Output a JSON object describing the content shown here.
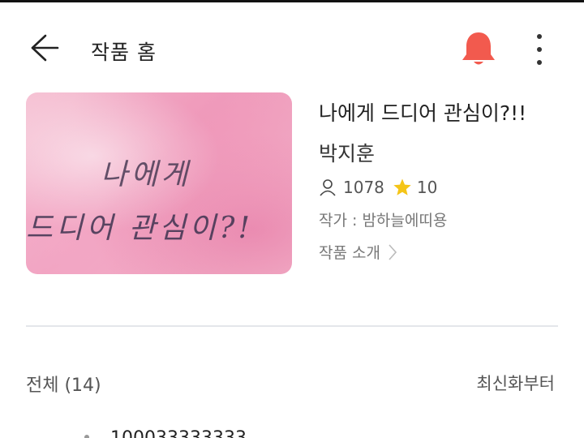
{
  "header": {
    "title": "작품 홈",
    "back_icon": "arrow-left-icon",
    "bell_icon": "bell-icon",
    "bell_color": "#f25a4e",
    "more_icon": "more-vertical-icon"
  },
  "work": {
    "cover_line1": "나에게",
    "cover_line2": "드디어 관심이?!",
    "title": "나에게 드디어 관심이?!!",
    "author": "박지훈",
    "views": "1078",
    "rating": "10",
    "writer": "작가 : 밤하늘에띠용",
    "intro_link": "작품 소개",
    "star_color": "#f5c518"
  },
  "episodes": {
    "all_label": "전체 (14)",
    "sort_label": "최신화부터",
    "first_item_partial": "100033333333"
  }
}
